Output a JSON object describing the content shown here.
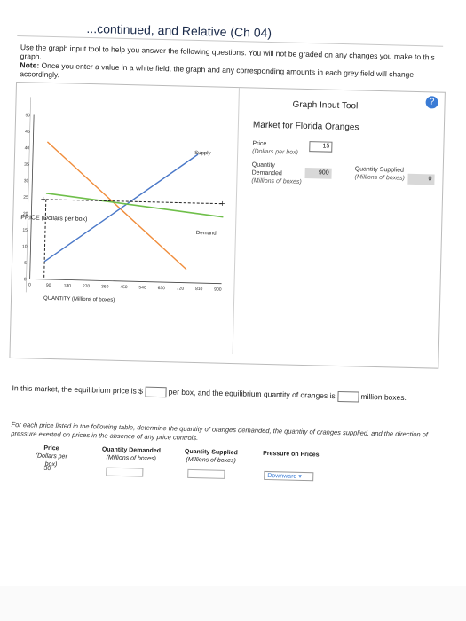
{
  "header": {
    "title": "...continued, and Relative (Ch 04)"
  },
  "instructions": "Use the graph input tool to help you answer the following questions. You will not be graded on any changes you make to this graph.",
  "note": {
    "label": "Note:",
    "body": "Once you enter a value in a white field, the graph and any corresponding amounts in each grey field will change accordingly."
  },
  "tool": {
    "help_glyph": "?",
    "title": "Graph Input Tool",
    "market": "Market for Florida Oranges",
    "price_label": "Price",
    "price_unit": "(Dollars per box)",
    "price_value": "15",
    "qd_label_1": "Quantity",
    "qd_label_2": "Demanded",
    "qd_unit": "(Millions of boxes)",
    "qd_value": "900",
    "qs_label": "Quantity Supplied",
    "qs_unit": "(Millions of boxes)",
    "qs_value": "0"
  },
  "chart_data": {
    "type": "line",
    "xlabel": "QUANTITY (Millions of boxes)",
    "ylabel": "PRICE (Dollars per box)",
    "x_ticks": [
      "0",
      "90",
      "180",
      "270",
      "360",
      "450",
      "540",
      "630",
      "720",
      "810",
      "900"
    ],
    "y_ticks": [
      "0",
      "5",
      "10",
      "15",
      "20",
      "25",
      "30",
      "35",
      "40",
      "45",
      "50"
    ],
    "xlim": [
      0,
      900
    ],
    "ylim": [
      0,
      50
    ],
    "series": [
      {
        "name": "Supply",
        "color": "#4a78c8"
      },
      {
        "name": "Demand",
        "color": "#6fbf4a"
      }
    ]
  },
  "equilibrium": {
    "text1": "In this market, the equilibrium price is $",
    "text2": "per box, and the equilibrium quantity of oranges is",
    "text3": "million boxes."
  },
  "table_instructions": "For each price listed in the following table, determine the quantity of oranges demanded, the quantity of oranges supplied, and the direction of pressure exerted on prices in the absence of any price controls.",
  "table": {
    "headers": [
      {
        "label": "Price",
        "unit": "(Dollars per box)"
      },
      {
        "label": "Quantity Demanded",
        "unit": "(Millions of boxes)"
      },
      {
        "label": "Quantity Supplied",
        "unit": "(Millions of boxes)"
      },
      {
        "label": "Pressure on Prices"
      }
    ],
    "rows": [
      {
        "price": "30",
        "pressure": "Downward"
      }
    ]
  }
}
